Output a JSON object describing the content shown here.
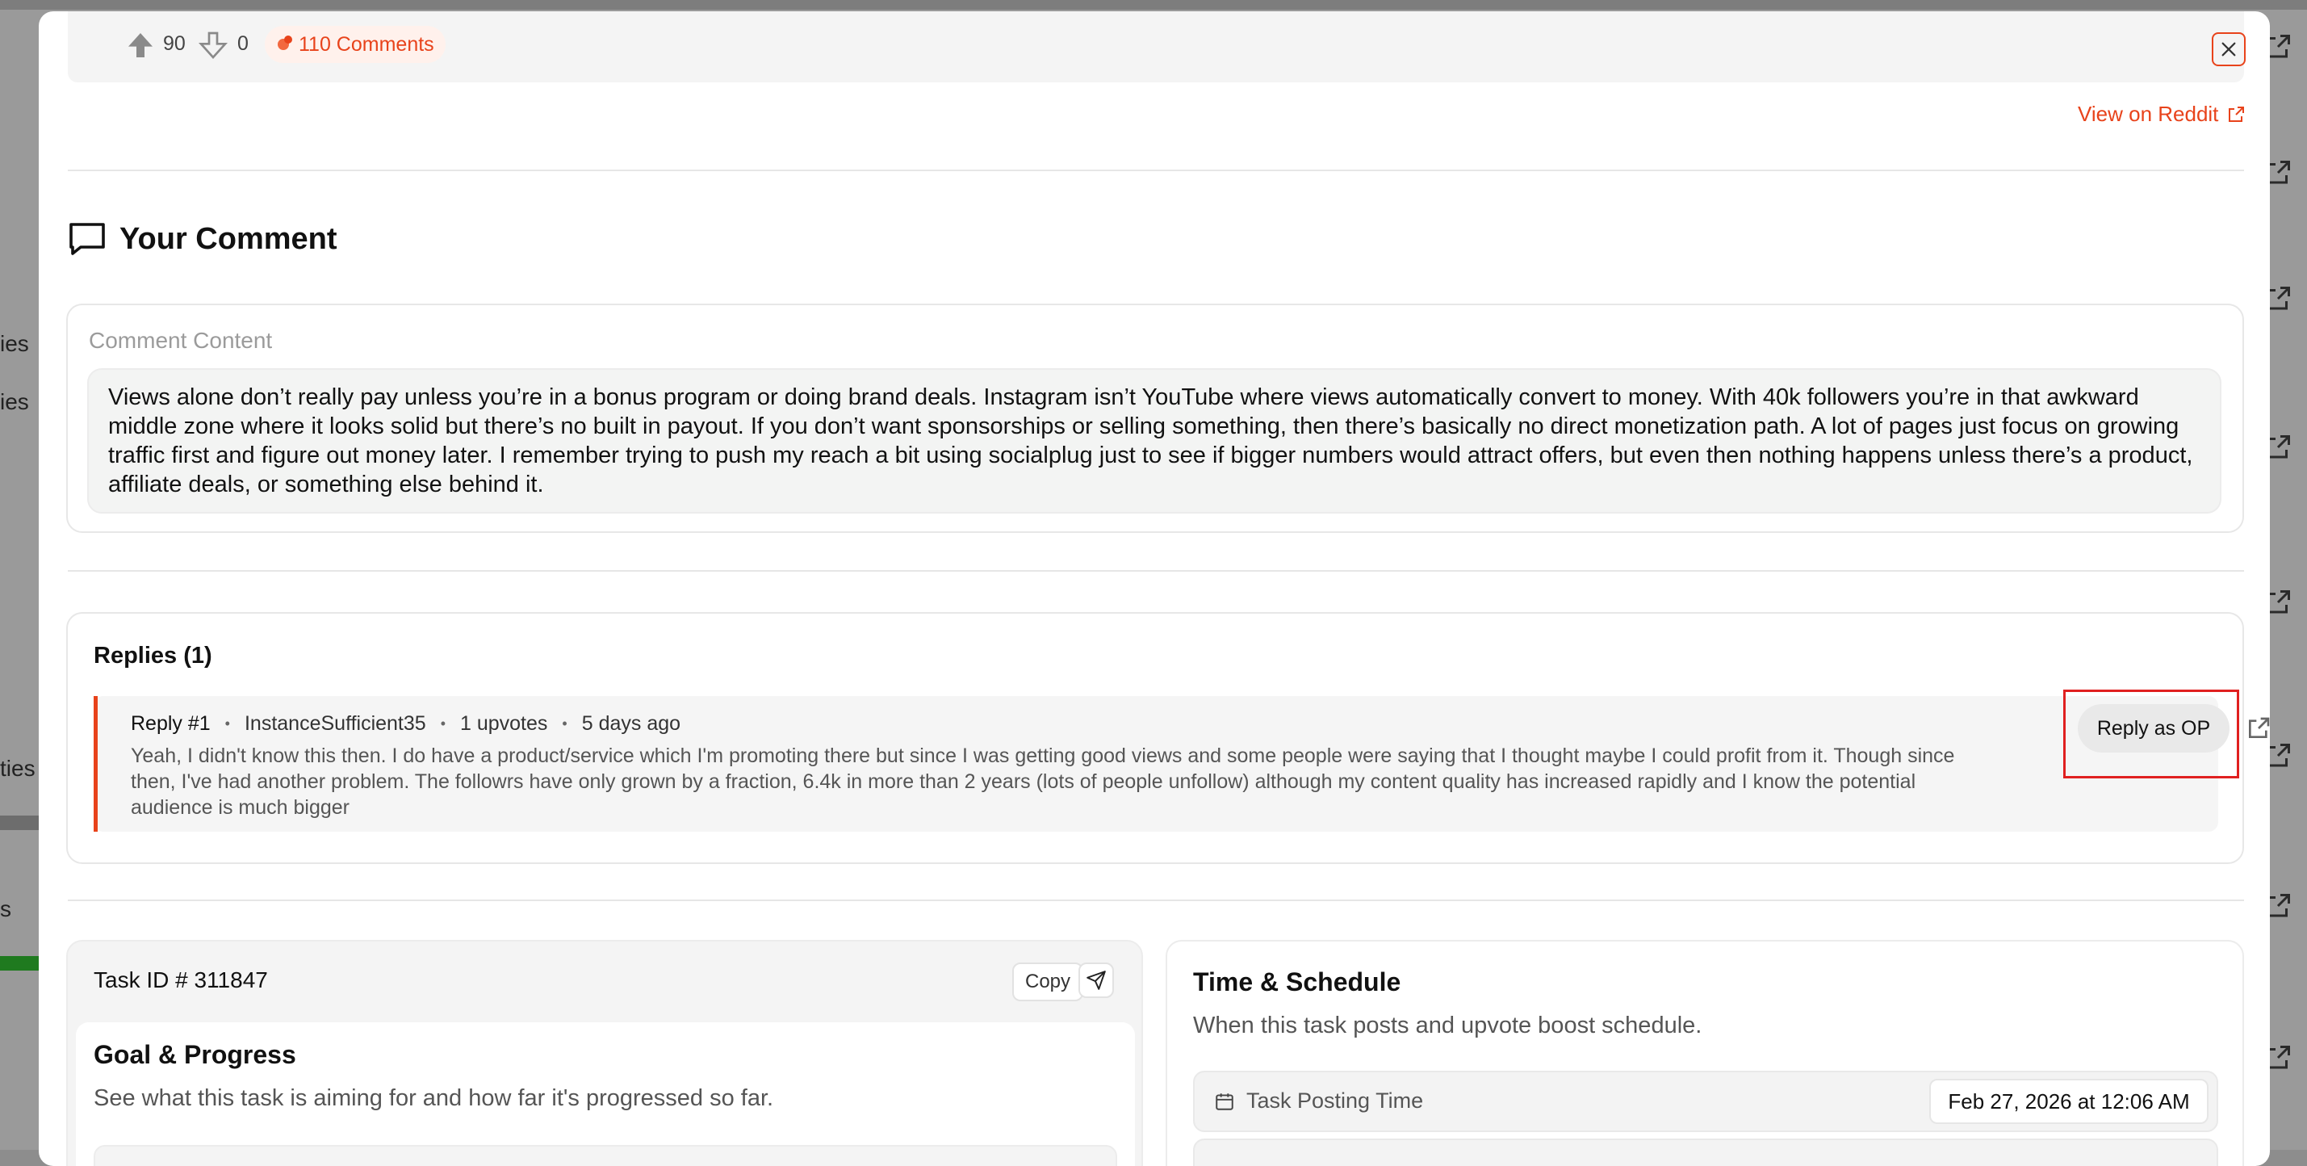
{
  "background": {
    "left_fragments": [
      "ies",
      "ies",
      "ties",
      "s"
    ]
  },
  "post_bar": {
    "upvotes": "90",
    "downvotes": "0",
    "comments_label": "110 Comments"
  },
  "header": {
    "view_on_reddit": "View on Reddit"
  },
  "your_comment": {
    "title": "Your Comment",
    "content_label": "Comment Content",
    "content": "Views alone don’t really pay unless you’re in a bonus program or doing brand deals. Instagram isn’t YouTube where views automatically convert to money. With 40k followers you’re in that awkward middle zone where it looks solid but there’s no built in payout. If you don’t want sponsorships or selling something, then there’s basically no direct monetization path. A lot of pages just focus on growing traffic first and figure out money later. I remember trying to push my reach a bit using socialplug just to see if bigger numbers would attract offers, but even then nothing happens unless there’s a product, affiliate deals, or something else behind it."
  },
  "replies": {
    "title": "Replies (1)",
    "items": [
      {
        "label": "Reply #1",
        "author": "InstanceSufficient35",
        "upvotes": "1 upvotes",
        "age": "5 days ago",
        "text": "Yeah, I didn't know this then. I do have a product/service which I'm promoting there but since I was getting good views and some people were saying that I thought maybe I could profit from it. Though since then, I've had another problem. The followrs have only grown by a fraction, 6.4k in more than 2 years (lots of people unfollow) although my content quality has increased rapidly and I know the potential audience is much bigger",
        "reply_button": "Reply as OP"
      }
    ]
  },
  "task": {
    "id_label": "Task ID # 311847",
    "copy_label": "Copy",
    "goal_title": "Goal & Progress",
    "goal_subtitle": "See what this task is aiming for and how far it's progressed so far."
  },
  "schedule": {
    "title": "Time & Schedule",
    "subtitle": "When this task posts and upvote boost schedule.",
    "posting_label": "Task Posting Time",
    "posting_value": "Feb 27, 2026 at 12:06 AM"
  },
  "colors": {
    "accent": "#e8431b",
    "highlight_frame": "#e02020"
  }
}
